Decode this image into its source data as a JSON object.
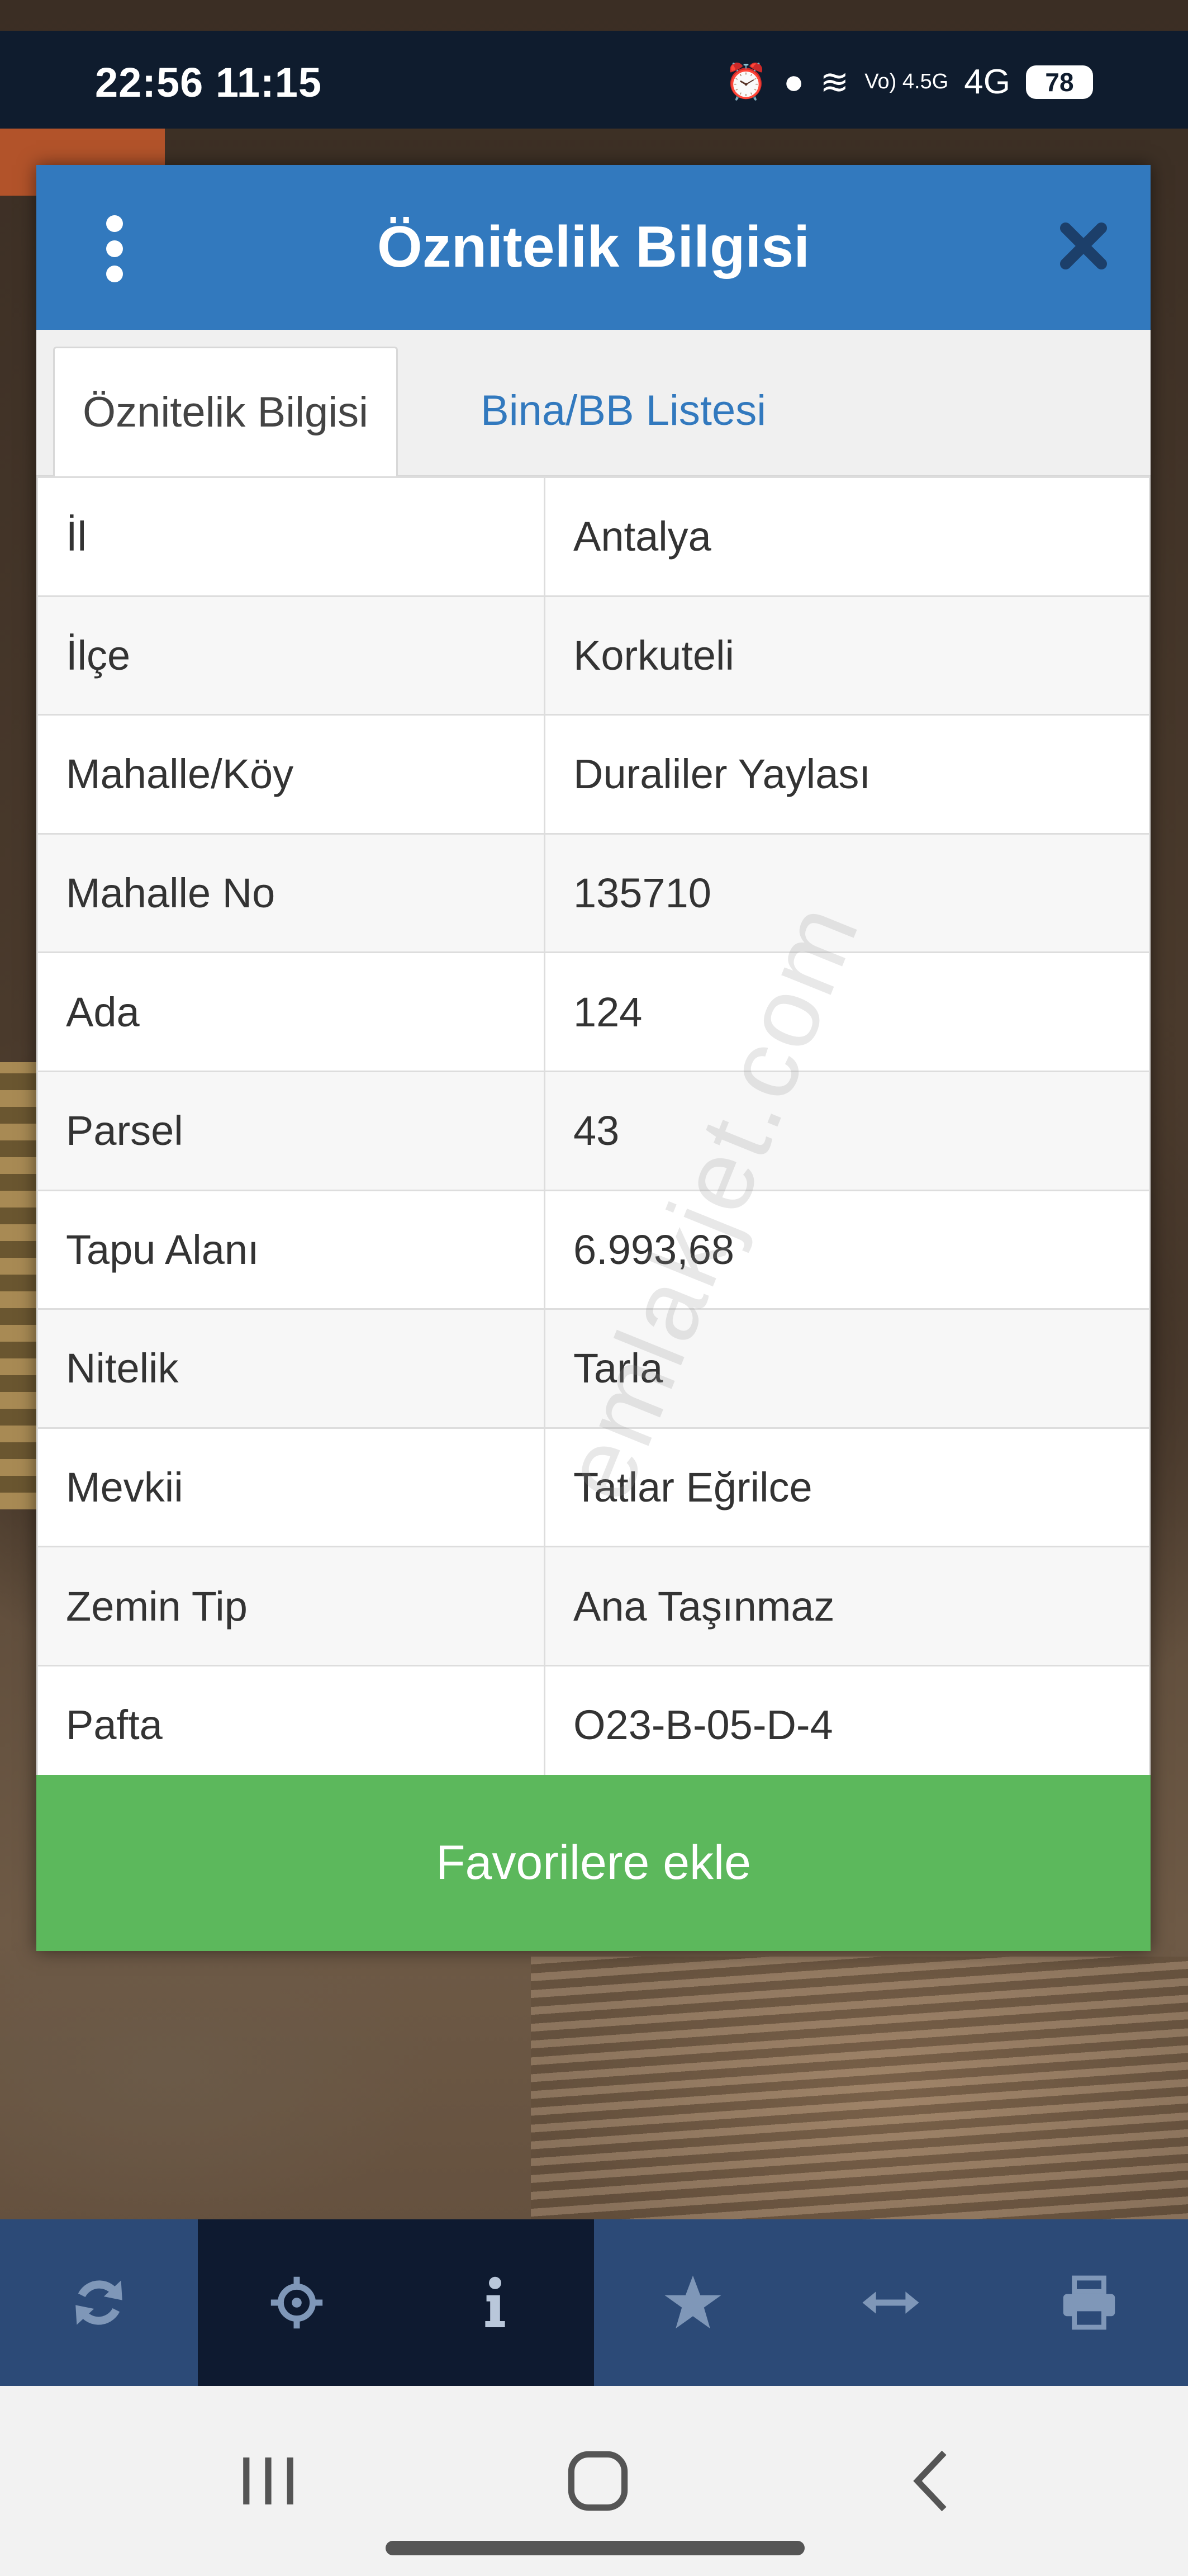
{
  "status_bar": {
    "time": "22:56 11:15",
    "network": "4G",
    "signal_label": "Vo) 4.5G",
    "battery": "78"
  },
  "dialog": {
    "title": "Öznitelik Bilgisi",
    "tabs": [
      {
        "label": "Öznitelik Bilgisi",
        "active": true
      },
      {
        "label": "Bina/BB Listesi",
        "active": false
      }
    ],
    "rows": [
      {
        "key": "İl",
        "value": "Antalya"
      },
      {
        "key": "İlçe",
        "value": "Korkuteli"
      },
      {
        "key": "Mahalle/Köy",
        "value": "Duraliler Yaylası"
      },
      {
        "key": "Mahalle No",
        "value": "135710"
      },
      {
        "key": "Ada",
        "value": "124"
      },
      {
        "key": "Parsel",
        "value": "43"
      },
      {
        "key": "Tapu Alanı",
        "value": "6.993,68"
      },
      {
        "key": "Nitelik",
        "value": "Tarla"
      },
      {
        "key": "Mevkii",
        "value": "Tatlar Eğrilce"
      },
      {
        "key": "Zemin Tip",
        "value": "Ana Taşınmaz"
      },
      {
        "key": "Pafta",
        "value": "O23-B-05-D-4"
      }
    ],
    "favorite_button": "Favorilere ekle"
  },
  "watermark": "emlakjet.com",
  "toolbar": {
    "items": [
      {
        "icon": "refresh-icon",
        "active": false
      },
      {
        "icon": "locate-icon",
        "active": true
      },
      {
        "icon": "info-icon",
        "active": true
      },
      {
        "icon": "star-icon",
        "active": false
      },
      {
        "icon": "measure-icon",
        "active": false
      },
      {
        "icon": "print-icon",
        "active": false
      }
    ]
  },
  "colors": {
    "header": "#3279be",
    "favorite": "#5cb85c",
    "toolbar": "#2c4a77",
    "toolbar_active": "#0e1a30"
  }
}
